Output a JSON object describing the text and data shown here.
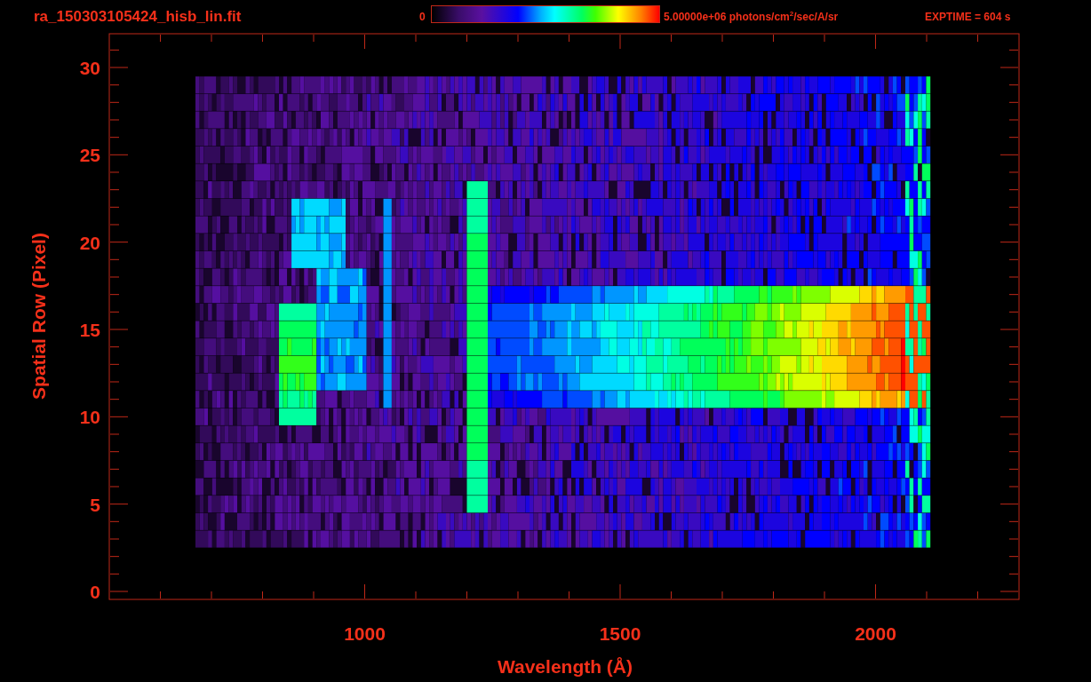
{
  "title": "ra_150303105424_hisb_lin.fit",
  "colorbar": {
    "min_label": "0",
    "max_label": "5.00000e+06 photons/cm$^{2}$/sec/A/sr"
  },
  "exposure": "EXPTIME = 604 s",
  "plot": {
    "xlabel": "Wavelength (Å)",
    "ylabel": "Spatial Row (Pixel)",
    "xticks": [
      "1000",
      "1500",
      "2000"
    ],
    "yticks": [
      "30",
      "25",
      "20",
      "15",
      "10",
      "5",
      "0"
    ]
  }
}
